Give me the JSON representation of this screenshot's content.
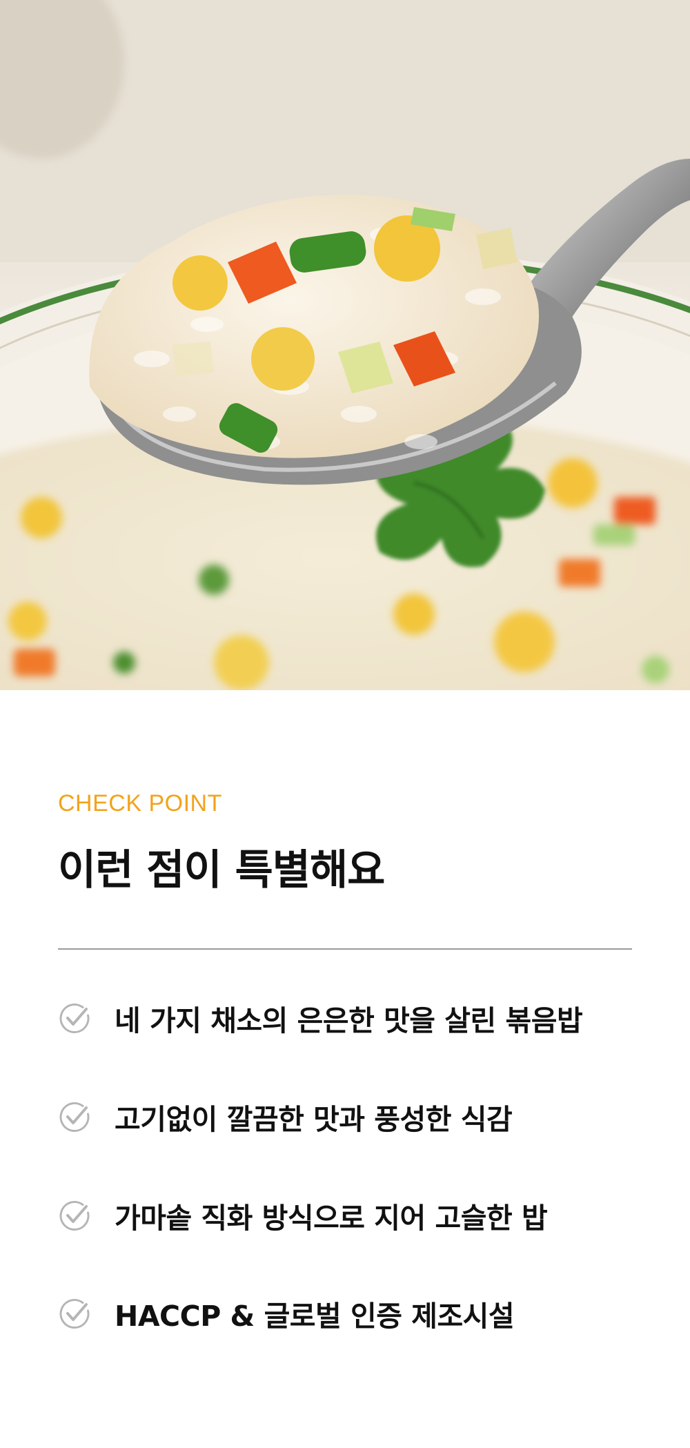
{
  "hero": {
    "image": "fried-rice-photo",
    "description_icon": "spoon-of-fried-rice-image"
  },
  "content": {
    "eyebrow": "CHECK POINT",
    "title": "이런 점이 특별해요",
    "features": [
      {
        "icon": "check-circle-icon",
        "label": "네 가지 채소의 은은한 맛을 살린 볶음밥"
      },
      {
        "icon": "check-circle-icon",
        "label": "고기없이 깔끔한 맛과 풍성한 식감"
      },
      {
        "icon": "check-circle-icon",
        "label": "가마솥 직화 방식으로 지어 고슬한 밥"
      },
      {
        "icon": "check-circle-icon",
        "label": "HACCP & 글로벌 인증 제조시설"
      }
    ]
  },
  "colors": {
    "accent": "#f2a31b",
    "text": "#111111",
    "divider": "#9a9a9a",
    "check": "#b5b5b5"
  }
}
